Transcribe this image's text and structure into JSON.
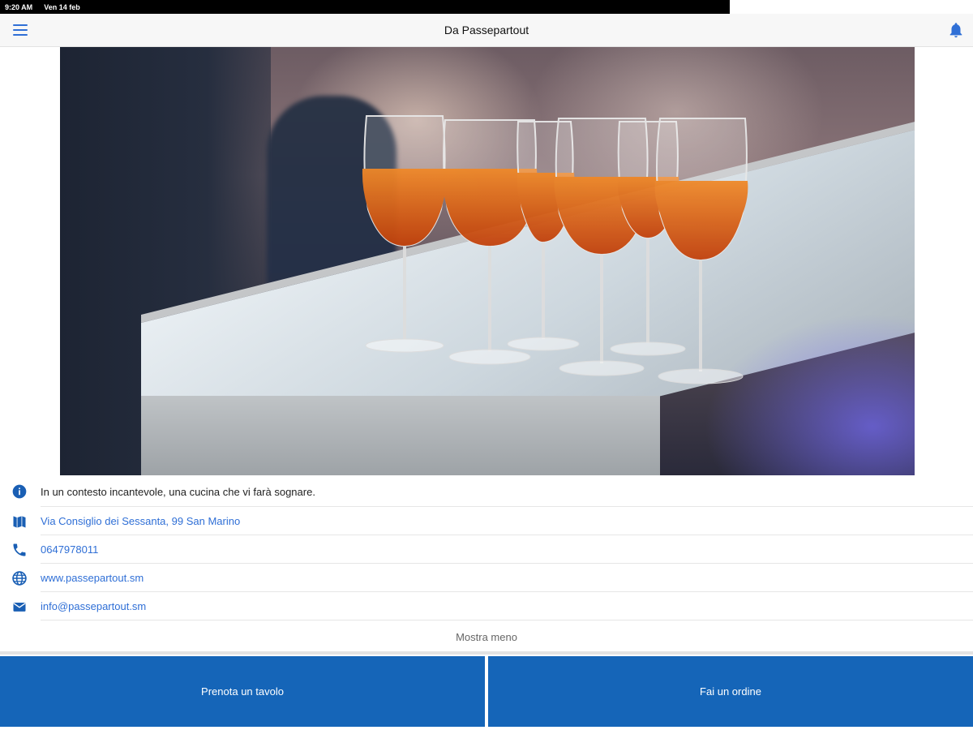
{
  "status_bar": {
    "time": "9:20 AM",
    "date": "Ven 14 feb"
  },
  "header": {
    "title": "Da Passepartout"
  },
  "hero": {
    "icon": "spritz-glasses-photo"
  },
  "info": {
    "description": "In un contesto incantevole, una cucina che vi farà sognare.",
    "address": "Via Consiglio dei Sessanta, 99 San Marino",
    "phone": "0647978011",
    "website": "www.passepartout.sm",
    "email": "info@passepartout.sm"
  },
  "toggle_label": "Mostra meno",
  "actions": {
    "book_label": "Prenota un tavolo",
    "order_label": "Fai un ordine"
  },
  "colors": {
    "accent": "#2f6fd6",
    "button_bg": "#1565b8",
    "icon_dark": "#1a5fb4"
  }
}
